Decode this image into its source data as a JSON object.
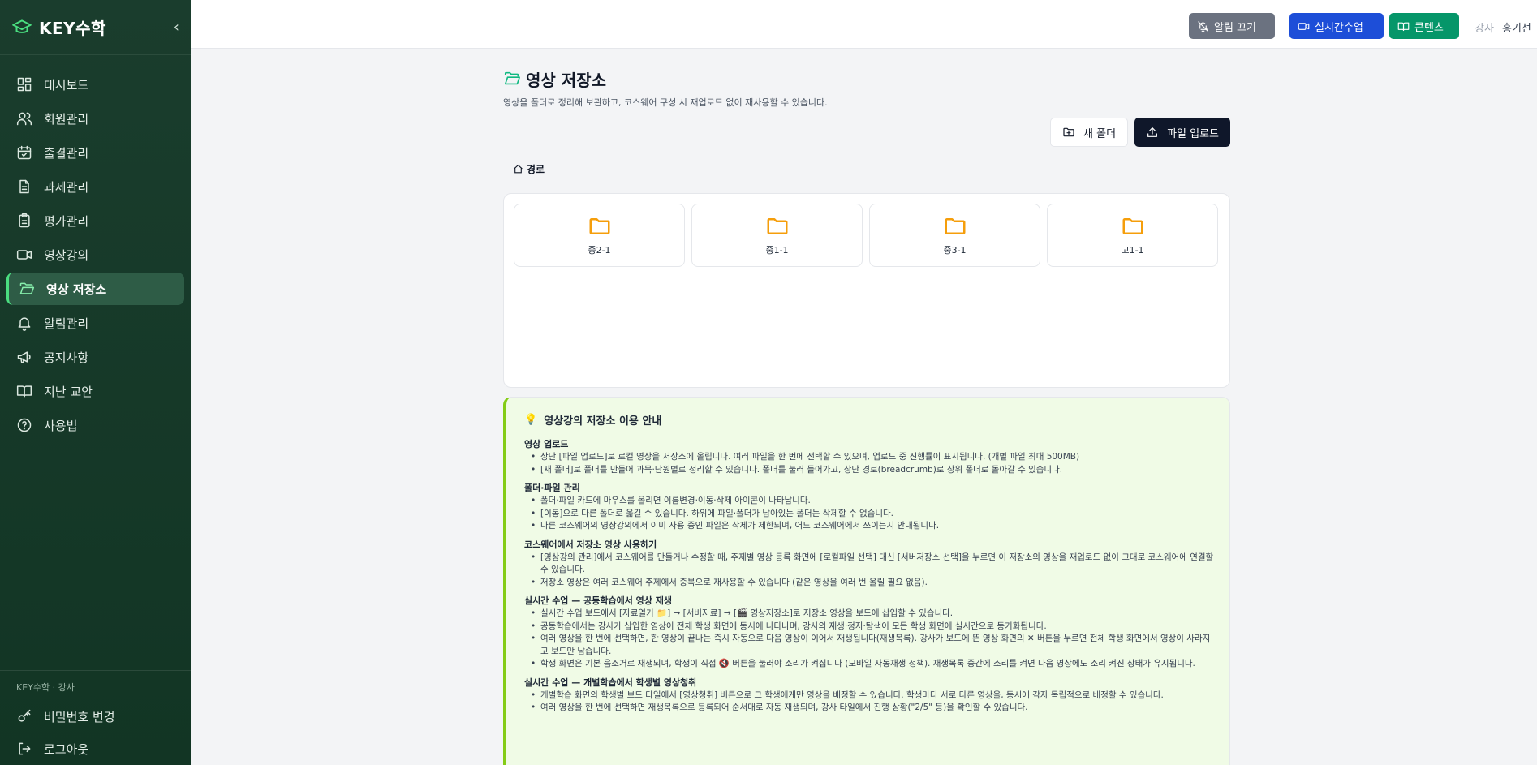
{
  "brand": {
    "name": "KEY수학",
    "collapse_icon": "chevron-left-icon"
  },
  "nav": [
    {
      "label": "대시보드",
      "icon": "dashboard-icon",
      "active": false
    },
    {
      "label": "회원관리",
      "icon": "users-icon",
      "active": false
    },
    {
      "label": "출결관리",
      "icon": "calendar-check-icon",
      "active": false
    },
    {
      "label": "과제관리",
      "icon": "document-icon",
      "active": false
    },
    {
      "label": "평가관리",
      "icon": "clipboard-icon",
      "active": false
    },
    {
      "label": "영상강의",
      "icon": "video-icon",
      "active": false
    },
    {
      "label": "영상 저장소",
      "icon": "folder-open-icon",
      "active": true
    },
    {
      "label": "알림관리",
      "icon": "bell-icon",
      "active": false
    },
    {
      "label": "공지사항",
      "icon": "megaphone-icon",
      "active": false
    },
    {
      "label": "지난 교안",
      "icon": "book-icon",
      "active": false
    },
    {
      "label": "사용법",
      "icon": "help-icon",
      "active": false
    }
  ],
  "footer": {
    "caption": "KEY수학 · 강사",
    "password_label": "비밀번호 변경",
    "logout_label": "로그아웃"
  },
  "header": {
    "mute_label": "알림 끄기",
    "live_label": "실시간수업",
    "content_label": "콘텐츠",
    "role": "강사",
    "user_name": "홍기선"
  },
  "page": {
    "title": "영상 저장소",
    "subtitle": "영상을 폴더로 정리해 보관하고, 코스웨어 구성 시 재업로드 없이 재사용할 수 있습니다.",
    "new_folder_label": "새 폴더",
    "upload_label": "파일 업로드",
    "breadcrumb_root": "경로"
  },
  "folders": [
    "중2-1",
    "중1-1",
    "중3-1",
    "고1-1"
  ],
  "guide": {
    "icon": "💡",
    "title": "영상강의 저장소 이용 안내",
    "sections": [
      {
        "heading": "영상 업로드",
        "items": [
          "상단 [파일 업로드]로 로컬 영상을 저장소에 올립니다. 여러 파일을 한 번에 선택할 수 있으며, 업로드 중 진행률이 표시됩니다. (개별 파일 최대 500MB)",
          "[새 폴더]로 폴더를 만들어 과목·단원별로 정리할 수 있습니다. 폴더를 눌러 들어가고, 상단 경로(breadcrumb)로 상위 폴더로 돌아갈 수 있습니다."
        ]
      },
      {
        "heading": "폴더·파일 관리",
        "items": [
          "폴더·파일 카드에 마우스를 올리면 이름변경·이동·삭제 아이콘이 나타납니다.",
          "[이동]으로 다른 폴더로 옮길 수 있습니다. 하위에 파일·폴더가 남아있는 폴더는 삭제할 수 없습니다.",
          "다른 코스웨어의 영상강의에서 이미 사용 중인 파일은 삭제가 제한되며, 어느 코스웨어에서 쓰이는지 안내됩니다."
        ]
      },
      {
        "heading": "코스웨어에서 저장소 영상 사용하기",
        "items": [
          "[영상강의 관리]에서 코스웨어를 만들거나 수정할 때, 주제별 영상 등록 화면에 [로컬파일 선택] 대신 [서버저장소 선택]을 누르면 이 저장소의 영상을 재업로드 없이 그대로 코스웨어에 연결할 수 있습니다.",
          "저장소 영상은 여러 코스웨어·주제에서 중복으로 재사용할 수 있습니다 (같은 영상을 여러 번 올릴 필요 없음)."
        ]
      },
      {
        "heading": "실시간 수업 — 공동학습에서 영상 재생",
        "items": [
          "실시간 수업 보드에서 [자료열기 📁] → [서버자료] → [🎬 영상저장소]로 저장소 영상을 보드에 삽입할 수 있습니다.",
          "공동학습에서는 강사가 삽입한 영상이 전체 학생 화면에 동시에 나타나며, 강사의 재생·정지·탐색이 모든 학생 화면에 실시간으로 동기화됩니다.",
          "여러 영상을 한 번에 선택하면, 한 영상이 끝나는 즉시 자동으로 다음 영상이 이어서 재생됩니다(재생목록). 강사가 보드에 뜬 영상 화면의 ✕ 버튼을 누르면 전체 학생 화면에서 영상이 사라지고 보드만 남습니다.",
          "학생 화면은 기본 음소거로 재생되며, 학생이 직접 🔇 버튼을 눌러야 소리가 켜집니다 (모바일 자동재생 정책). 재생목록 중간에 소리를 켜면 다음 영상에도 소리 켜진 상태가 유지됩니다."
        ]
      },
      {
        "heading": "실시간 수업 — 개별학습에서 학생별 영상청취",
        "items": [
          "개별학습 화면의 학생별 보드 타일에서 [영상청취] 버튼으로 그 학생에게만 영상을 배정할 수 있습니다. 학생마다 서로 다른 영상을, 동시에 각자 독립적으로 배정할 수 있습니다.",
          "여러 영상을 한 번에 선택하면 재생목록으로 등록되어 순서대로 자동 재생되며, 강사 타일에서 진행 상황(\"2/5\" 등)을 확인할 수 있습니다."
        ]
      }
    ]
  }
}
